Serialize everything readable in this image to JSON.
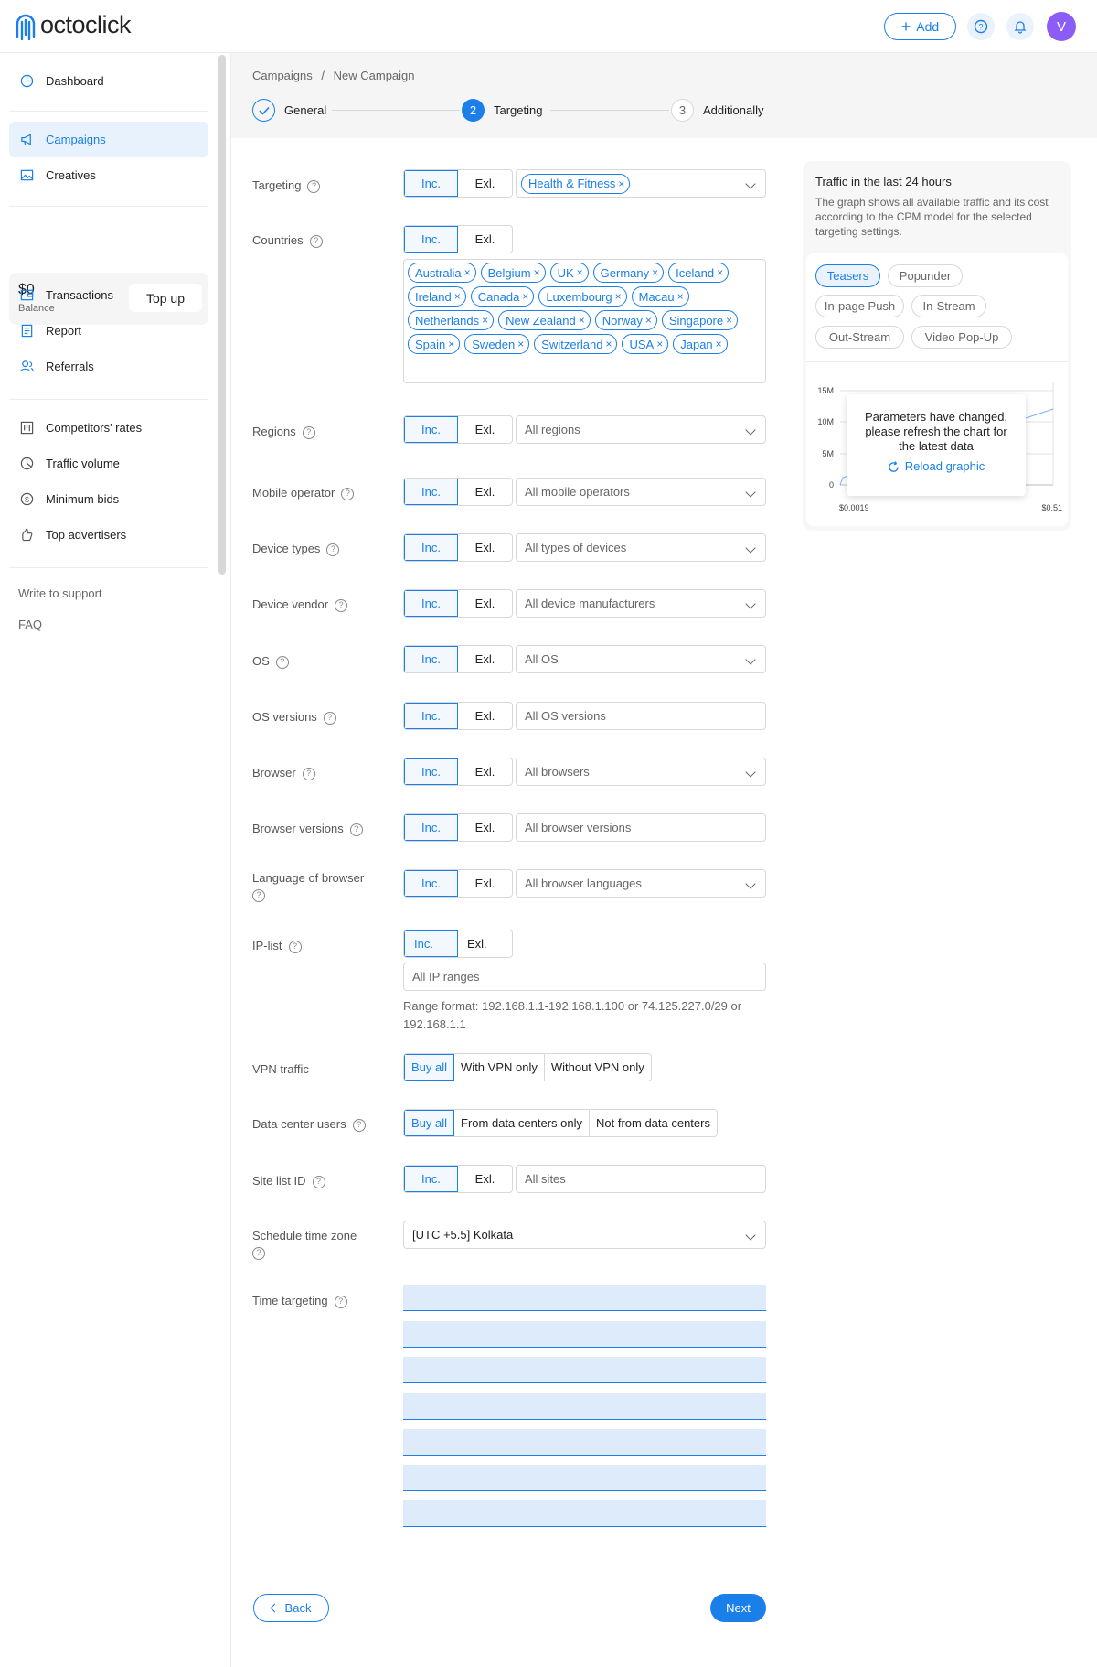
{
  "header": {
    "brand": "octoclick",
    "add_label": "Add",
    "avatar_letter": "V",
    "accent_color": "#1a7fe8"
  },
  "sidebar": {
    "items": [
      {
        "label": "Dashboard",
        "icon": "pie-chart-icon"
      },
      {
        "label": "Campaigns",
        "icon": "megaphone-icon"
      },
      {
        "label": "Creatives",
        "icon": "image-icon"
      },
      {
        "label": "Transactions",
        "icon": "wallet-icon"
      },
      {
        "label": "Report",
        "icon": "report-icon"
      },
      {
        "label": "Referrals",
        "icon": "users-icon"
      },
      {
        "label": "Competitors' rates",
        "icon": "bar-chart-icon"
      },
      {
        "label": "Traffic volume",
        "icon": "pie-icon"
      },
      {
        "label": "Minimum bids",
        "icon": "dollar-icon"
      },
      {
        "label": "Top advertisers",
        "icon": "thumb-up-icon"
      }
    ],
    "balance_amount": "$0",
    "balance_label": "Balance",
    "topup_label": "Top up",
    "support_label": "Write to support",
    "faq_label": "FAQ"
  },
  "breadcrumb": {
    "parent": "Campaigns",
    "separator": "/",
    "current": "New Campaign"
  },
  "steps": [
    {
      "num": "",
      "label": "General",
      "state": "done"
    },
    {
      "num": "2",
      "label": "Targeting",
      "state": "active"
    },
    {
      "num": "3",
      "label": "Additionally",
      "state": "todo"
    }
  ],
  "form": {
    "inc_label": "Inc.",
    "exl_label": "Exl.",
    "targeting": {
      "label": "Targeting",
      "chip": "Health & Fitness"
    },
    "countries": {
      "label": "Countries",
      "chips": [
        "Australia",
        "Belgium",
        "UK",
        "Germany",
        "Iceland",
        "Ireland",
        "Canada",
        "Luxembourg",
        "Macau",
        "Netherlands",
        "New Zealand",
        "Norway",
        "Singapore",
        "Spain",
        "Sweden",
        "Switzerland",
        "USA",
        "Japan"
      ]
    },
    "regions": {
      "label": "Regions",
      "placeholder": "All regions"
    },
    "mobile_operator": {
      "label": "Mobile operator",
      "placeholder": "All mobile operators"
    },
    "device_types": {
      "label": "Device types",
      "placeholder": "All types of devices"
    },
    "device_vendor": {
      "label": "Device vendor",
      "placeholder": "All device manufacturers"
    },
    "os": {
      "label": "OS",
      "placeholder": "All OS"
    },
    "os_versions": {
      "label": "OS versions",
      "placeholder": "All OS versions"
    },
    "browser": {
      "label": "Browser",
      "placeholder": "All browsers"
    },
    "browser_versions": {
      "label": "Browser versions",
      "placeholder": "All browser versions"
    },
    "browser_language": {
      "label": "Language of browser",
      "placeholder": "All browser languages"
    },
    "ip_list": {
      "label": "IP-list",
      "placeholder": "All IP ranges",
      "hint": "Range format: 192.168.1.1-192.168.1.100 or 74.125.227.0/29 or 192.168.1.1"
    },
    "vpn": {
      "label": "VPN traffic",
      "options": [
        "Buy all",
        "With VPN only",
        "Without VPN only"
      ]
    },
    "datacenter": {
      "label": "Data center users",
      "options": [
        "Buy all",
        "From data centers only",
        "Not from data centers"
      ]
    },
    "site_list": {
      "label": "Site list ID",
      "placeholder": "All sites"
    },
    "timezone": {
      "label": "Schedule time zone",
      "value": "[UTC +5.5] Kolkata"
    },
    "time_targeting": {
      "label": "Time targeting"
    },
    "back_label": "Back",
    "next_label": "Next"
  },
  "traffic_panel": {
    "title": "Traffic in the last 24 hours",
    "description": "The graph shows all available traffic and its cost according to the CPM model for the selected targeting settings.",
    "formats": [
      "Teasers",
      "Popunder",
      "In-page Push",
      "In-Stream",
      "Out-Stream",
      "Video Pop-Up"
    ],
    "selected_format": "Teasers",
    "overlay_text": "Parameters have changed, please refresh the chart for the latest data",
    "reload_label": "Reload graphic"
  },
  "chart_data": {
    "type": "line",
    "y_ticks": [
      "15M",
      "10M",
      "5M",
      "0"
    ],
    "x_ticks": [
      "$0.0019",
      "$0.51"
    ]
  }
}
